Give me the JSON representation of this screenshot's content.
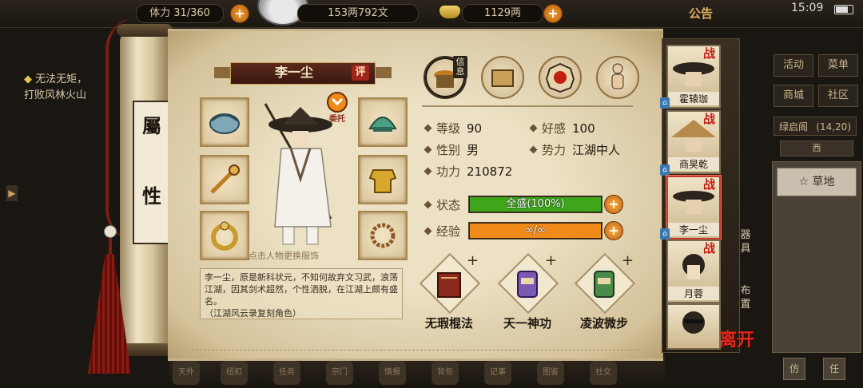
{
  "topbar": {
    "stamina": "体力 31/360",
    "coins": "153两792文",
    "gold": "1129两",
    "notice": "公告",
    "clock": "15:09"
  },
  "quest": {
    "title": "无法无矩，",
    "detail": "打败风林火山"
  },
  "right_menu": {
    "activity": "活动",
    "menu": "菜单",
    "shop": "商城",
    "community": "社区",
    "location": "绿启阁",
    "location_coord": "(14,20)",
    "direction": "西",
    "terrain": "草地",
    "btn1": "仿",
    "btn2": "任"
  },
  "scroll": {
    "category_chars": "屬\n性"
  },
  "character": {
    "name": "李一尘",
    "eval_badge": "评",
    "commission_label": "委托",
    "hint": "点击人物更换服饰",
    "bio_main": "李一尘，原是新科状元，不知何故弃文习武，浪荡江湖，因其剑术超然，个性洒脱，在江湖上颇有盛名。",
    "bio_sub": "（江湖风云录复刻角色）"
  },
  "tabs": {
    "info_label": "信息"
  },
  "stats": {
    "level_label": "等级",
    "level": "90",
    "affinity_label": "好感",
    "affinity": "100",
    "gender_label": "性别",
    "gender": "男",
    "faction_label": "势力",
    "faction": "江湖中人",
    "power_label": "功力",
    "power": "210872",
    "state_label": "状态",
    "state_value": "全盛(100%)",
    "state_fill": 1.0,
    "exp_label": "经验",
    "exp_value": "∞/∞",
    "exp_fill": 1.0
  },
  "skills": [
    {
      "name": "无瑕棍法"
    },
    {
      "name": "天一神功"
    },
    {
      "name": "凌波微步"
    }
  ],
  "party": [
    {
      "name": "霍辕珈",
      "tag": "战"
    },
    {
      "name": "商昊乾",
      "tag": "战"
    },
    {
      "name": "李一尘",
      "tag": "战"
    },
    {
      "name": "月蓉",
      "tag": "战"
    },
    {
      "name": "",
      "tag": ""
    }
  ],
  "side_labels": {
    "gear": "器具",
    "layout": "布置"
  },
  "leave_label": "离开",
  "bottom_bar": [
    "天外",
    "纽扣",
    "任务",
    "宗门",
    "情报",
    "背包",
    "记事",
    "图鉴",
    "社交"
  ],
  "colors": {
    "state_bar": "#3fa61c",
    "exp_bar": "#f08a1a",
    "accent_red": "#c21e14"
  }
}
